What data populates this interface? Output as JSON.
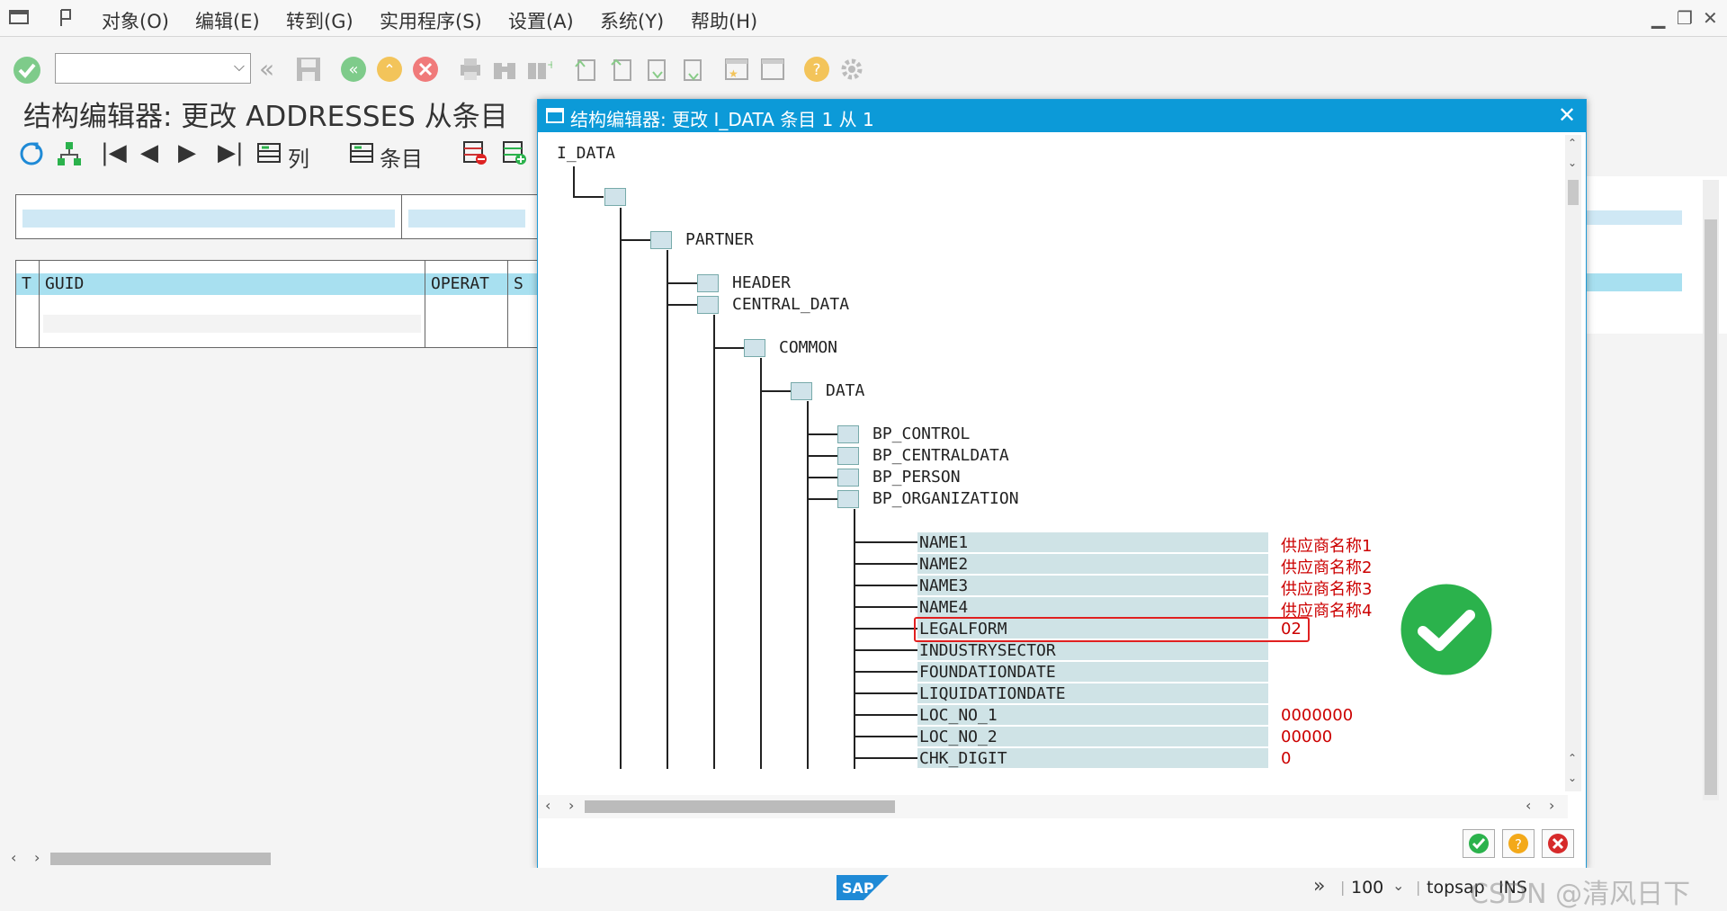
{
  "menubar": {
    "items": [
      "对象(O)",
      "编辑(E)",
      "转到(G)",
      "实用程序(S)",
      "设置(A)",
      "系统(Y)",
      "帮助(H)"
    ]
  },
  "toolbar": {
    "command_field": {
      "value": "",
      "placeholder": ""
    }
  },
  "page": {
    "title": "结构编辑器: 更改 ADDRESSES 从条目",
    "func_labels": {
      "columns": "列",
      "entries": "条目"
    },
    "table": {
      "headers": [
        "T",
        "GUID",
        "OPERAT",
        "S"
      ]
    }
  },
  "dialog": {
    "title": "结构编辑器: 更改 I_DATA 条目 1 从 1",
    "tree": {
      "root": "I_DATA",
      "partner": "PARTNER",
      "header": "HEADER",
      "central_data": "CENTRAL_DATA",
      "common": "COMMON",
      "data": "DATA",
      "bp_control": "BP_CONTROL",
      "bp_centraldata": "BP_CENTRALDATA",
      "bp_person": "BP_PERSON",
      "bp_organization": "BP_ORGANIZATION"
    },
    "fields": [
      {
        "name": "NAME1",
        "value": "供应商名称1"
      },
      {
        "name": "NAME2",
        "value": "供应商名称2"
      },
      {
        "name": "NAME3",
        "value": "供应商名称3"
      },
      {
        "name": "NAME4",
        "value": "供应商名称4"
      },
      {
        "name": "LEGALFORM",
        "value": "02"
      },
      {
        "name": "INDUSTRYSECTOR",
        "value": ""
      },
      {
        "name": "FOUNDATIONDATE",
        "value": ""
      },
      {
        "name": "LIQUIDATIONDATE",
        "value": ""
      },
      {
        "name": "LOC_NO_1",
        "value": "0000000"
      },
      {
        "name": "LOC_NO_2",
        "value": "00000"
      },
      {
        "name": "CHK_DIGIT",
        "value": "0"
      }
    ]
  },
  "statusbar": {
    "zoom": "100",
    "system": "topsap",
    "mode": "INS",
    "watermark": "CSDN @清风日下",
    "logo": "SAP"
  },
  "colors": {
    "dialog_title_bg": "#0c9ad8",
    "field_bg": "#cfe3e6",
    "field_value": "#cc0000",
    "highlight": "#e02020",
    "check_badge": "#2bb24c"
  }
}
